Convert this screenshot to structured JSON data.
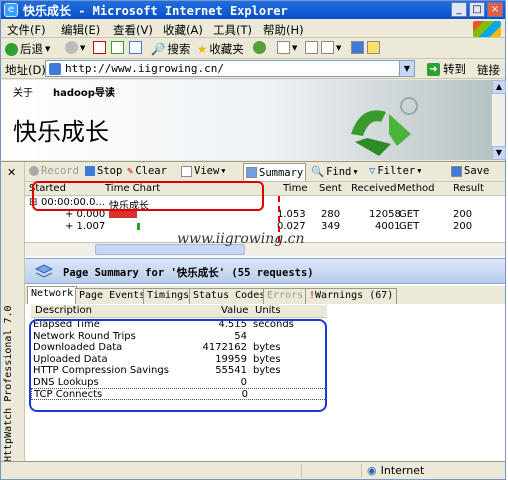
{
  "window": {
    "title": "快乐成长 - Microsoft Internet Explorer",
    "buttons": [
      "_",
      "□",
      "×"
    ]
  },
  "menu": [
    "文件(F)",
    "编辑(E)",
    "查看(V)",
    "收藏(A)",
    "工具(T)",
    "帮助(H)"
  ],
  "toolbar": {
    "back": "后退",
    "search": "搜索",
    "favorites": "收藏夹"
  },
  "address": {
    "label": "地址(D)",
    "url": "http://www.iigrowing.cn/",
    "go": "转到",
    "links": "链接"
  },
  "webpage": {
    "nav_about": "关于",
    "nav_hadoop": "hadoop导读",
    "site_title": "快乐成长"
  },
  "httpwatch": {
    "brand": "HttpWatch Professional 7.0",
    "toolbar": {
      "record": "Record",
      "stop": "Stop",
      "clear": "Clear",
      "view": "View",
      "summary": "Summary",
      "find": "Find",
      "filter": "Filter",
      "save": "Save"
    },
    "grid_headers": {
      "started": "Started",
      "time_chart": "Time Chart",
      "time": "Time",
      "sent": "Sent",
      "received": "Received",
      "method": "Method",
      "result": "Result"
    },
    "page_row": {
      "started": "00:00:00.0...",
      "title": "快乐成长"
    },
    "rows": [
      {
        "started": "+ 0.000",
        "time": "1.053",
        "sent": "280",
        "received": "12058",
        "method": "GET",
        "result": "200"
      },
      {
        "started": "+ 1.007",
        "time": "0.027",
        "sent": "349",
        "received": "4001",
        "method": "GET",
        "result": "200"
      }
    ],
    "watermark": "www.iigrowing.cn",
    "page_summary": "Page Summary for '快乐成长' (55 requests)",
    "tabs": [
      "Network",
      "Page Events",
      "Timings",
      "Status Codes",
      "Errors",
      "Warnings (67)"
    ],
    "table_headers": {
      "description": "Description",
      "value": "Value",
      "units": "Units"
    },
    "table_rows": [
      {
        "description": "Elapsed Time",
        "value": "4.515",
        "units": "seconds"
      },
      {
        "description": "Network Round Trips",
        "value": "54",
        "units": ""
      },
      {
        "description": "Downloaded Data",
        "value": "4172162",
        "units": "bytes"
      },
      {
        "description": "Uploaded Data",
        "value": "19959",
        "units": "bytes"
      },
      {
        "description": "HTTP Compression Savings",
        "value": "55541",
        "units": "bytes"
      },
      {
        "description": "DNS Lookups",
        "value": "0",
        "units": ""
      },
      {
        "description": "TCP Connects",
        "value": "0",
        "units": ""
      }
    ]
  },
  "status": {
    "zone": "Internet"
  }
}
